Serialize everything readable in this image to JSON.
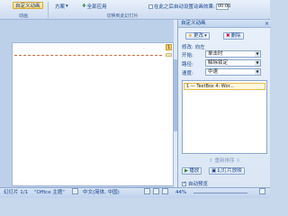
{
  "ribbon": {
    "group1_button": "自定义动画",
    "group1_label": "动画",
    "scheme_label": "方案",
    "apply_all": "全部应用",
    "group2_label": "切换到此幻灯片",
    "auto_after_label": "在此之后自动设置动画效果:",
    "auto_after_value": "00:00"
  },
  "slide": {
    "anim_index": "1"
  },
  "pane": {
    "title": "自定义动画",
    "change_button": "更改",
    "delete_button": "删除",
    "modify_label": "修改: 向左",
    "start_label": "开始:",
    "start_value": "单击时",
    "direction_label": "路径:",
    "direction_value": "解除锁定",
    "speed_label": "速度:",
    "speed_value": "中速",
    "anim_item": "1  — TextBox 4: Wor...",
    "reorder_label": "重新排序",
    "play_button": "播放",
    "slideshow_button": "幻灯片放映",
    "auto_preview_label": "自动预览"
  },
  "status": {
    "slide_info": "幻灯片 1/1",
    "theme": "\"Office 主题\"",
    "language": "中文(简体, 中国)",
    "zoom": "44%"
  }
}
